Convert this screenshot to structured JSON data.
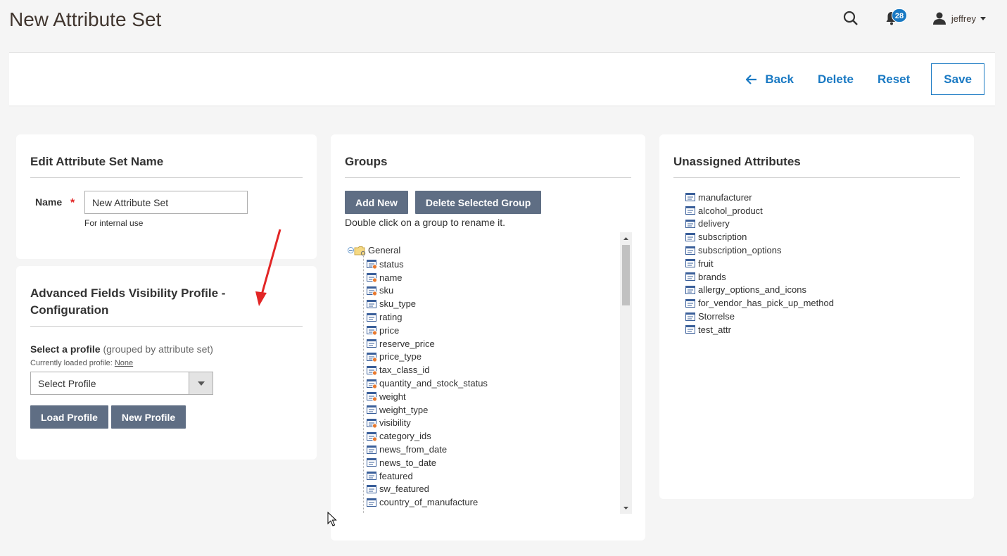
{
  "page": {
    "title": "New Attribute Set"
  },
  "header": {
    "notification_count": "28",
    "username": "jeffrey"
  },
  "actions": {
    "back": "Back",
    "delete": "Delete",
    "reset": "Reset",
    "save": "Save"
  },
  "name_section": {
    "title": "Edit Attribute Set Name",
    "label": "Name",
    "required_mark": "*",
    "value": "New Attribute Set",
    "note": "For internal use"
  },
  "profile_section": {
    "title_line1": "Advanced Fields Visibility Profile -",
    "title_line2": "Configuration",
    "select_label": "Select a profile",
    "select_sub": "(grouped by attribute set)",
    "loaded_prefix": "Currently loaded profile:",
    "loaded_value": "None",
    "select_value": "Select Profile",
    "load_btn": "Load Profile",
    "new_btn": "New Profile"
  },
  "groups_section": {
    "title": "Groups",
    "add_btn": "Add New",
    "delete_btn": "Delete Selected Group",
    "hint": "Double click on a group to rename it.",
    "root": "General",
    "items": [
      {
        "label": "status",
        "system": true
      },
      {
        "label": "name",
        "system": true
      },
      {
        "label": "sku",
        "system": true
      },
      {
        "label": "sku_type",
        "system": false
      },
      {
        "label": "rating",
        "system": false
      },
      {
        "label": "price",
        "system": true
      },
      {
        "label": "reserve_price",
        "system": false
      },
      {
        "label": "price_type",
        "system": true
      },
      {
        "label": "tax_class_id",
        "system": true
      },
      {
        "label": "quantity_and_stock_status",
        "system": true
      },
      {
        "label": "weight",
        "system": true
      },
      {
        "label": "weight_type",
        "system": false
      },
      {
        "label": "visibility",
        "system": true
      },
      {
        "label": "category_ids",
        "system": true
      },
      {
        "label": "news_from_date",
        "system": false
      },
      {
        "label": "news_to_date",
        "system": false
      },
      {
        "label": "featured",
        "system": false
      },
      {
        "label": "sw_featured",
        "system": false
      },
      {
        "label": "country_of_manufacture",
        "system": false
      }
    ]
  },
  "unassigned_section": {
    "title": "Unassigned Attributes",
    "items": [
      "manufacturer",
      "alcohol_product",
      "delivery",
      "subscription",
      "subscription_options",
      "fruit",
      "brands",
      "allergy_options_and_icons",
      "for_vendor_has_pick_up_method",
      "Storrelse",
      "test_attr"
    ]
  },
  "colors": {
    "accent": "#1979c3",
    "button_gray": "#5f6e84",
    "annotation_arrow": "#e22626"
  }
}
